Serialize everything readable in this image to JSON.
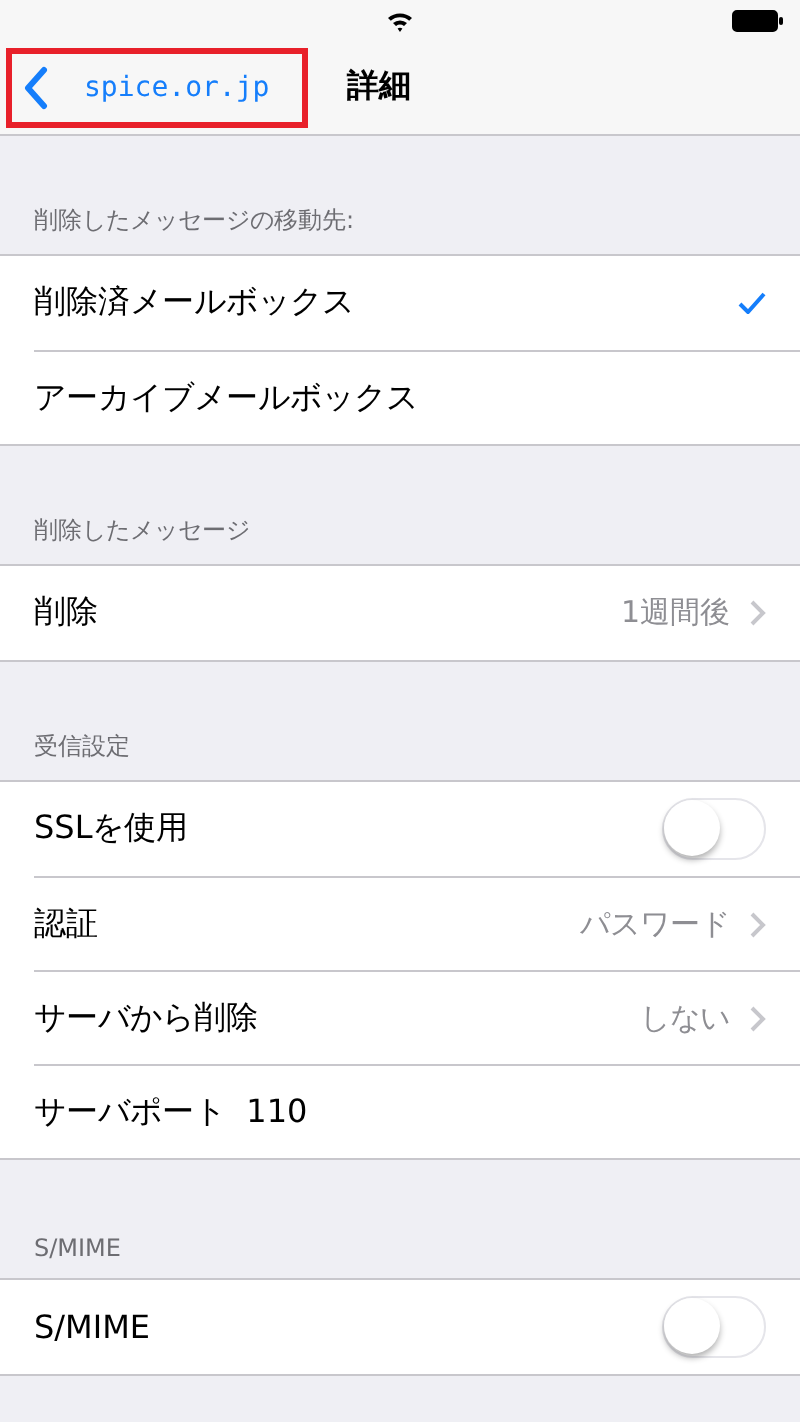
{
  "nav": {
    "back": {
      "label": "spice.or.jp",
      "highlighted": true
    },
    "title": "詳細"
  },
  "sections": [
    {
      "header": "削除したメッセージの移動先:",
      "rows": [
        {
          "kind": "check",
          "label": "削除済メールボックス",
          "checked": true
        },
        {
          "kind": "check",
          "label": "アーカイブメールボックス",
          "checked": false
        }
      ]
    },
    {
      "header": "削除したメッセージ",
      "rows": [
        {
          "kind": "detail",
          "label": "削除",
          "value": "1週間後"
        }
      ]
    },
    {
      "header": "受信設定",
      "rows": [
        {
          "kind": "toggle",
          "label": "SSLを使用",
          "on": false
        },
        {
          "kind": "detail",
          "label": "認証",
          "value": "パスワード"
        },
        {
          "kind": "detail",
          "label": "サーバから削除",
          "value": "しない"
        },
        {
          "kind": "plain",
          "label": "サーバポート  110"
        }
      ]
    },
    {
      "header": "S/MIME",
      "rows": [
        {
          "kind": "toggle",
          "label": "S/MIME",
          "on": false
        }
      ]
    }
  ]
}
